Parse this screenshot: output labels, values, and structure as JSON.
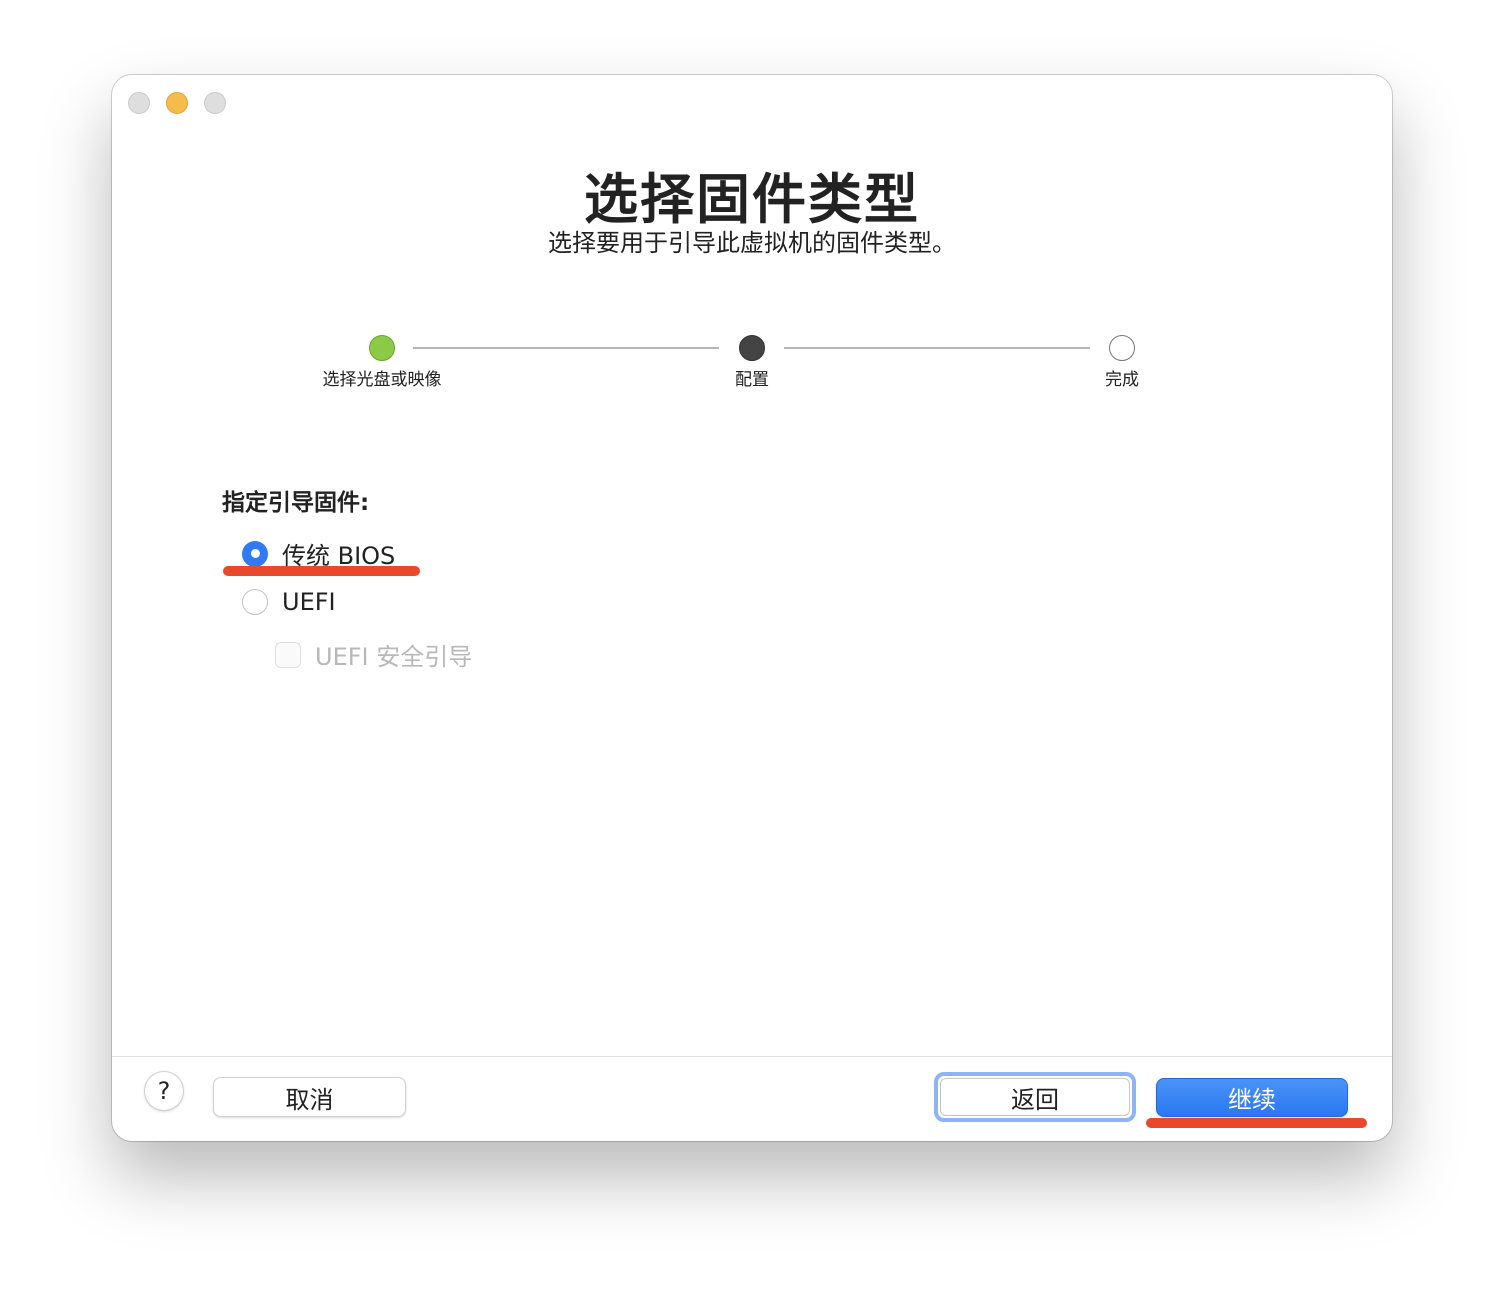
{
  "window": {
    "title": "选择固件类型",
    "subtitle": "选择要用于引导此虚拟机的固件类型。"
  },
  "steps": [
    {
      "label": "选择光盘或映像",
      "state": "done"
    },
    {
      "label": "配置",
      "state": "current"
    },
    {
      "label": "完成",
      "state": "future"
    }
  ],
  "firmware": {
    "section_label": "指定引导固件:",
    "options": [
      {
        "label": "传统 BIOS",
        "selected": true
      },
      {
        "label": "UEFI",
        "selected": false
      }
    ],
    "secure_boot": {
      "label": "UEFI 安全引导",
      "checked": false,
      "enabled": false
    }
  },
  "footer": {
    "help_label": "?",
    "cancel_label": "取消",
    "back_label": "返回",
    "continue_label": "继续"
  },
  "colors": {
    "accent": "#2f7bf5",
    "step_done": "#8cca46",
    "annotation": "#e9482b"
  }
}
